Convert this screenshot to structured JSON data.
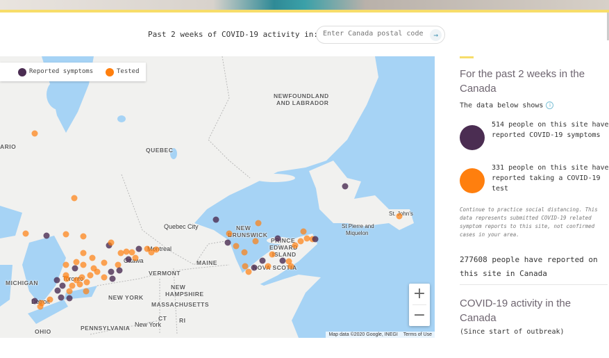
{
  "search": {
    "label": "Past 2 weeks of COVID-19 activity in:",
    "placeholder": "Enter Canada postal code",
    "go_icon": "arrow-right-icon"
  },
  "map": {
    "legend": {
      "symptoms": "Reported symptoms",
      "tested": "Tested"
    },
    "colors": {
      "symptoms": "#4b2d52",
      "tested": "#ff7f0e",
      "water": "#a6d3f5",
      "land": "#f1f1ef"
    },
    "labels": {
      "ontario": "ARIO",
      "quebec": "QUEBEC",
      "nl1": "NEWFOUNDLAND",
      "nl2": "AND LABRADOR",
      "quebec_city": "Quebec City",
      "nb1": "NEW",
      "nb2": "BRUNSWICK",
      "pei1": "PRINCE",
      "pei2": "EDWARD",
      "pei3": "ISLAND",
      "ns": "NOVA SCOTIA",
      "spm1": "St Pierre and",
      "spm2": "Miquelon",
      "stjohns": "St. John's",
      "maine": "MAINE",
      "vermont": "VERMONT",
      "nh1": "NEW",
      "nh2": "HAMPSHIRE",
      "mass": "MASSACHUSETTS",
      "ny_state": "NEW YORK",
      "michigan": "MICHIGAN",
      "ottawa": "Ottawa",
      "montreal": "Montreal",
      "toronto": "Toronto",
      "detroit": "Detroit",
      "penn": "PENNSYLVANIA",
      "ny_city": "New York",
      "ct": "CT",
      "ri": "RI",
      "ohio": "OHIO"
    },
    "zoom_in": "+",
    "zoom_out": "−",
    "attribution": "Map data ©2020 Google, INEGI",
    "terms": "Terms of Use"
  },
  "sidebar": {
    "title": "For the past 2 weeks in the Canada",
    "subtitle": "The data below shows",
    "info_icon": "info-icon",
    "symptoms_text": "514 people on this site have reported COVID-19 symptoms",
    "tested_text": "331 people on this site have reported taking a COVID-19 test",
    "note": "Continue to practice social distancing. This data represents submitted COVID-19 related symptom reports to this site, not confirmed cases in your area.",
    "total": "277608 people have reported on this site in Canada",
    "activity_title": "COVID-19 activity in the Canada",
    "since": "(Since start of outbreak)"
  }
}
